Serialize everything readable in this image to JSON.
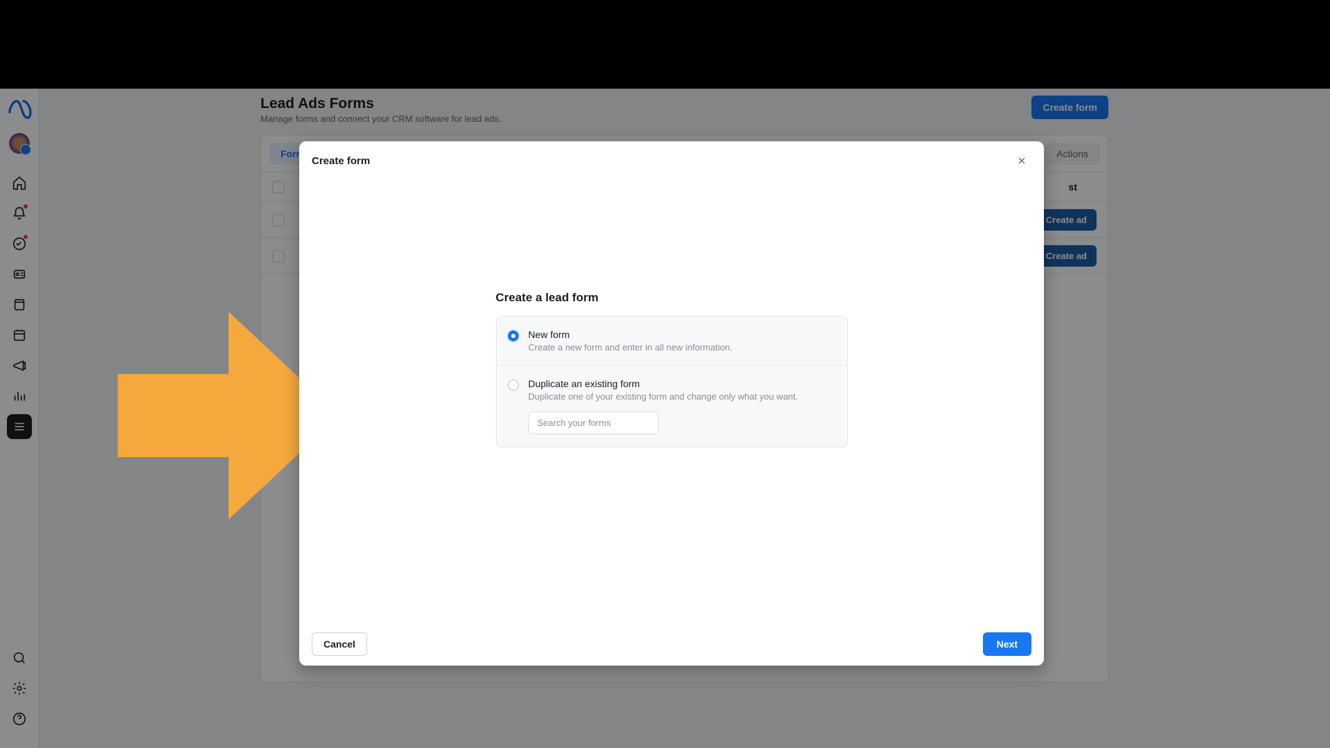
{
  "page": {
    "title": "Lead Ads Forms",
    "subtitle": "Manage forms and connect your CRM software for lead ads.",
    "create_form_button": "Create form"
  },
  "tabs": {
    "active_label": "Forms",
    "actions_label": "Actions"
  },
  "table": {
    "header_last_col": "st",
    "row_button": "Create ad"
  },
  "modal": {
    "title": "Create form",
    "section_title": "Create a lead form",
    "options": {
      "new_form": {
        "label": "New form",
        "desc": "Create a new form and enter in all new information."
      },
      "duplicate": {
        "label": "Duplicate an existing form",
        "desc": "Duplicate one of your existing form and change only what you want.",
        "search_placeholder": "Search your forms"
      }
    },
    "cancel_label": "Cancel",
    "next_label": "Next"
  },
  "colors": {
    "accent": "#1877f2",
    "arrow": "#f5a83c"
  }
}
